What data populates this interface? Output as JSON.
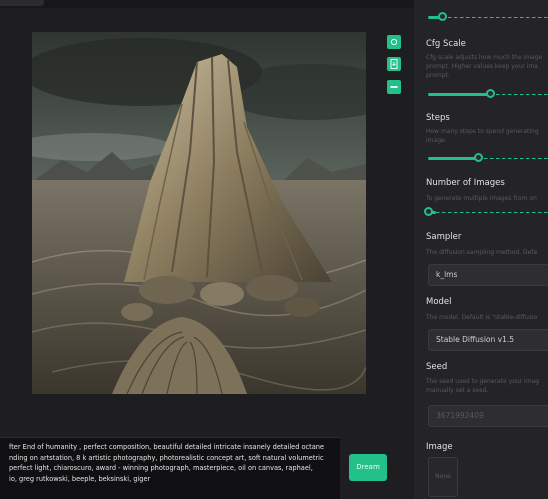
{
  "app": {
    "accent_color": "#22c08a",
    "background_color": "#1e1e20"
  },
  "canvas": {
    "alt": "Generated image: a rocky, layered mountain peak over a desolate desert plain under a stormy sky"
  },
  "toolbar": {
    "buttons": [
      {
        "icon": "view-icon"
      },
      {
        "icon": "download-icon"
      },
      {
        "icon": "more-icon"
      }
    ]
  },
  "settings": {
    "top_slider": {
      "value_fraction": 0.0
    },
    "cfg_scale": {
      "title": "Cfg Scale",
      "description_lines": [
        "Cfg scale adjusts how much the image",
        "prompt. Higher values keep your ima",
        "prompt."
      ],
      "value_fraction": 0.5
    },
    "steps": {
      "title": "Steps",
      "description_lines": [
        "How many steps to spend generating",
        "image."
      ],
      "value_fraction": 0.4
    },
    "number_of_images": {
      "title": "Number of Images",
      "description_lines": [
        "To generate multiple images from on"
      ],
      "value_fraction": 0.0
    },
    "sampler": {
      "title": "Sampler",
      "description_lines": [
        "The diffusion sampling method. Defa"
      ],
      "value": "k_lms"
    },
    "model": {
      "title": "Model",
      "description_lines": [
        "The model. Default is \"stable-diffusio"
      ],
      "value": "Stable Diffusion v1.5"
    },
    "seed": {
      "title": "Seed",
      "description_lines": [
        "The seed used to generate your imag",
        "manually set a seed."
      ],
      "value": "3671992409"
    },
    "image": {
      "title": "Image",
      "placeholder": "None"
    }
  },
  "prompt": {
    "lines": [
      "fter End of humanity , perfect composition, beautiful detailed intricate insanely detailed octane",
      "nding on artstation, 8 k artistic photography, photorealistic concept art, soft natural volumetric",
      "perfect light, chiaroscuro, award - winning photograph, masterpiece, oil on canvas, raphael,",
      "io, greg rutkowski, beeple, beksinski, giger"
    ]
  },
  "dream_button": {
    "label": "Dream"
  }
}
